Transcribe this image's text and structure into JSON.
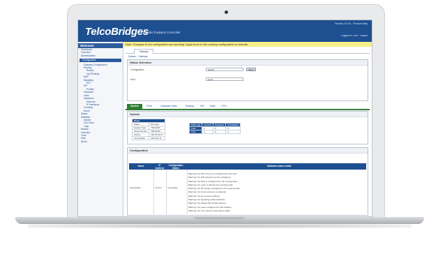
{
  "header": {
    "logo": "TelcoBridges",
    "subtitle": "Tmedia Toolpack Controller",
    "top_right_line1": "Version 2.6.34 · Product Help",
    "top_right_line2": "Logged in: root · Logout"
  },
  "banner": "Note: Changes to the configuration are pending. Apply them to the running configuration to activate.",
  "sidebar": {
    "title": "Welcome",
    "items": [
      {
        "label": "Dashboard",
        "level": 0
      },
      {
        "label": "Overview",
        "level": 0
      },
      {
        "label": "Administration",
        "level": 0
      },
      {
        "label": "Configuration",
        "level": 0,
        "selected": true
      },
      {
        "label": "Gateway Configuration",
        "level": 1
      },
      {
        "label": "Routing",
        "level": 1
      },
      {
        "label": "Routes",
        "level": 2
      },
      {
        "label": "Call Routing",
        "level": 2
      },
      {
        "label": "NAP",
        "level": 1
      },
      {
        "label": "Signaling",
        "level": 1
      },
      {
        "label": "SS7",
        "level": 2
      },
      {
        "label": "SIP",
        "level": 1
      },
      {
        "label": "Profiles",
        "level": 2
      },
      {
        "label": "Hardware",
        "level": 1
      },
      {
        "label": "Lines",
        "level": 1
      },
      {
        "label": "Interfaces",
        "level": 1
      },
      {
        "label": "Ethernet",
        "level": 2
      },
      {
        "label": "IP Interfaces",
        "level": 2
      },
      {
        "label": "Clocking",
        "level": 1
      },
      {
        "label": "Users",
        "level": 1
      },
      {
        "label": "Status",
        "level": 0
      },
      {
        "label": "Statistics",
        "level": 0
      },
      {
        "label": "Alarms",
        "level": 1
      },
      {
        "label": "Call Trace",
        "level": 1
      },
      {
        "label": "Logs",
        "level": 1
      },
      {
        "label": "Backup",
        "level": 0
      },
      {
        "label": "Licenses",
        "level": 0
      },
      {
        "label": "Tools",
        "level": 0
      },
      {
        "label": "Help",
        "level": 0
      },
      {
        "label": "About",
        "level": 0
      }
    ]
  },
  "tabs": {
    "active": "Gateway"
  },
  "crumbs": "System · Gateway",
  "status_panel": {
    "title": "Status Selection",
    "label_system": "Configuration",
    "select_system": "default",
    "button": "Select",
    "label_config": "Host",
    "select_config": "host1"
  },
  "group_tabs": [
    "System",
    "Ports",
    "Hardware Units",
    "Routing",
    "SIP",
    "Stats",
    "CPU"
  ],
  "system_panel": {
    "title": "System",
    "info_table": {
      "header": "Name",
      "rows": [
        [
          "Status",
          "Running"
        ],
        [
          "System Type",
          "TMG3200"
        ],
        [
          "Serial Number",
          "TB012345"
        ],
        [
          "Uptime",
          "12d 04:31:07"
        ],
        [
          "Last Update",
          "2014-06-12"
        ]
      ]
    },
    "call_table": {
      "headers": [
        "Call Legs",
        "Current",
        "Progress",
        "Completed"
      ],
      "rows": [
        [
          "Calls",
          "0",
          "0",
          "0"
        ],
        [
          "Total",
          "0",
          "0",
          "0"
        ]
      ]
    }
  },
  "config_panel": {
    "title": "Configuration",
    "headers": [
      "Name",
      "IP Address",
      "Configuration Status",
      "Validation status detail"
    ],
    "row_name": "tmg-default",
    "row_ip": "0.0.0.0",
    "row_status": "Incomplete",
    "details": [
      "Warning: No SS7 link set is configured for this host",
      "Warning: No SIP transport server configured",
      "Warning: No NAP is configured for the routing table",
      "Warning: No route is defined for incoming calls",
      "Warning: No IP interface assigned to the media profile",
      "Warning: No clock reference configured",
      "Warning: No line service defined",
      "Warning: No signaling profile attached",
      "Warning: No default SIP profile defined",
      "Warning: No stack configured for this adapter",
      "Warning: No user account with admin rights"
    ]
  }
}
